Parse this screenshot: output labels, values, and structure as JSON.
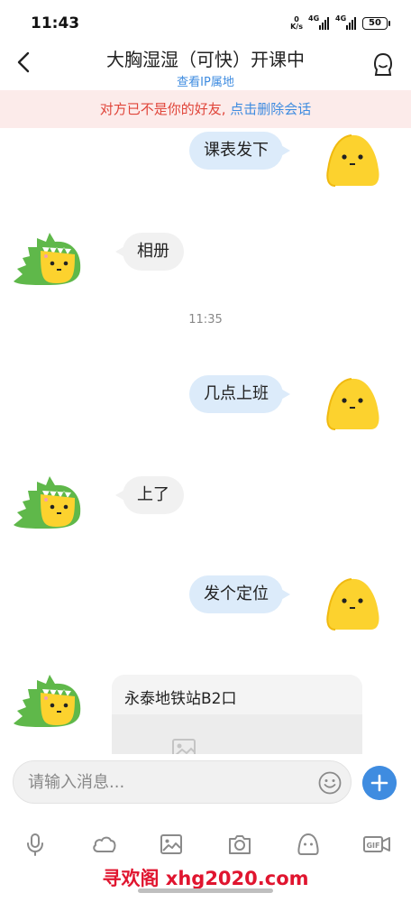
{
  "status_bar": {
    "time": "11:43",
    "net_speed_value": "0",
    "net_speed_unit": "K/s",
    "signal1": "4G",
    "signal2": "4G",
    "battery": "50"
  },
  "nav": {
    "title": "大胸湿湿（可快）开课中",
    "subtitle": "查看IP属地"
  },
  "warning": {
    "text": "对方已不是你的好友,",
    "link": " 点击删除会话"
  },
  "messages": {
    "m1": "课表发下",
    "m2": "相册",
    "timestamp": "11:35",
    "m3": "几点上班",
    "m4": "上了",
    "m5": "发个定位",
    "location_title": "永泰地铁站B2口"
  },
  "input": {
    "placeholder": "请输入消息..."
  },
  "toolbar": {
    "icons": [
      "microphone-icon",
      "cloud-icon",
      "image-icon",
      "camera-icon",
      "sticker-icon",
      "gif-icon"
    ]
  },
  "watermark": "寻欢阁 xhg2020.com",
  "colors": {
    "accent": "#3f8ce0",
    "warning_bg": "#fcebea",
    "warning_text": "#e0453a",
    "bubble_out": "#dcebfa",
    "bubble_in": "#f1f1f1"
  }
}
